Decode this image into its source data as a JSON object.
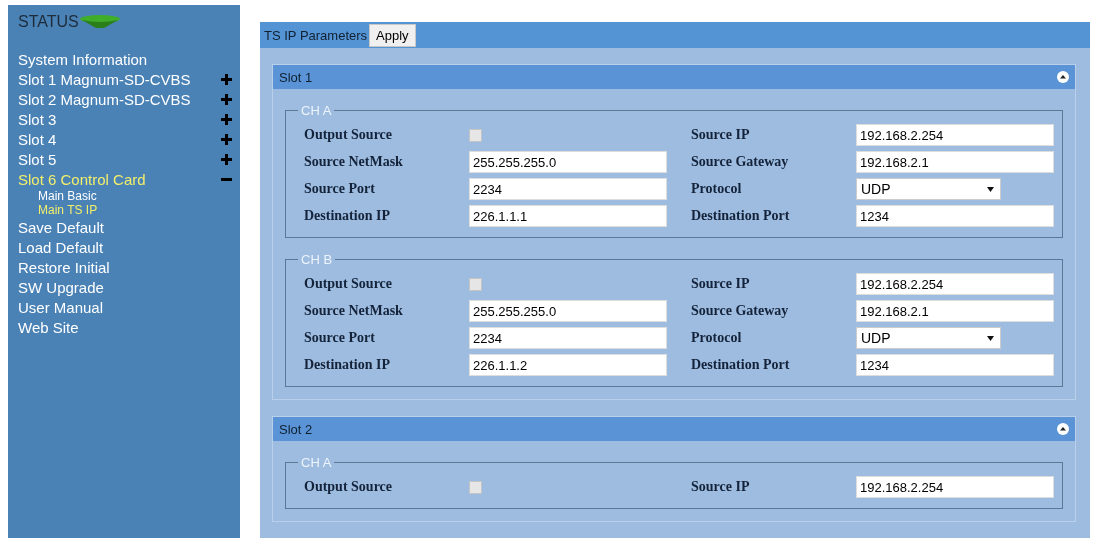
{
  "sidebar": {
    "title": "STATUS",
    "items": [
      {
        "label": "System Information",
        "selected": false
      },
      {
        "label": "Slot 1 Magnum-SD-CVBS",
        "selected": false,
        "expanded": false
      },
      {
        "label": "Slot 2 Magnum-SD-CVBS",
        "selected": false,
        "expanded": false
      },
      {
        "label": "Slot 3",
        "selected": false,
        "expanded": false
      },
      {
        "label": "Slot 4",
        "selected": false,
        "expanded": false
      },
      {
        "label": "Slot 5",
        "selected": false,
        "expanded": false
      },
      {
        "label": "Slot 6 Control Card",
        "selected": true,
        "expanded": true,
        "children": [
          {
            "label": "Main Basic",
            "selected": false
          },
          {
            "label": "Main TS IP",
            "selected": true
          }
        ]
      },
      {
        "label": "Save Default",
        "selected": false
      },
      {
        "label": "Load Default",
        "selected": false
      },
      {
        "label": "Restore Initial",
        "selected": false
      },
      {
        "label": "SW Upgrade",
        "selected": false
      },
      {
        "label": "User Manual",
        "selected": false
      },
      {
        "label": "Web Site",
        "selected": false
      }
    ]
  },
  "toolbar": {
    "title": "TS IP Parameters",
    "button": "Apply"
  },
  "slots": [
    {
      "title": "Slot 1",
      "expanded": true,
      "channels": [
        {
          "legend": "CH A",
          "fields": [
            {
              "label": "Output Source",
              "kind": "checkbox",
              "checked": false
            },
            {
              "label": "Source IP",
              "kind": "text",
              "value": "192.168.2.254"
            },
            {
              "label": "Source NetMask",
              "kind": "text",
              "value": "255.255.255.0"
            },
            {
              "label": "Source Gateway",
              "kind": "text",
              "value": "192.168.2.1"
            },
            {
              "label": "Source Port",
              "kind": "text",
              "value": "2234"
            },
            {
              "label": "Protocol",
              "kind": "select",
              "value": "UDP"
            },
            {
              "label": "Destination IP",
              "kind": "text",
              "value": "226.1.1.1"
            },
            {
              "label": "Destination Port",
              "kind": "text",
              "value": "1234"
            }
          ]
        },
        {
          "legend": "CH B",
          "fields": [
            {
              "label": "Output Source",
              "kind": "checkbox",
              "checked": false
            },
            {
              "label": "Source IP",
              "kind": "text",
              "value": "192.168.2.254"
            },
            {
              "label": "Source NetMask",
              "kind": "text",
              "value": "255.255.255.0"
            },
            {
              "label": "Source Gateway",
              "kind": "text",
              "value": "192.168.2.1"
            },
            {
              "label": "Source Port",
              "kind": "text",
              "value": "2234"
            },
            {
              "label": "Protocol",
              "kind": "select",
              "value": "UDP"
            },
            {
              "label": "Destination IP",
              "kind": "text",
              "value": "226.1.1.2"
            },
            {
              "label": "Destination Port",
              "kind": "text",
              "value": "1234"
            }
          ]
        }
      ]
    },
    {
      "title": "Slot 2",
      "expanded": true,
      "channels": [
        {
          "legend": "CH A",
          "fields": [
            {
              "label": "Output Source",
              "kind": "checkbox",
              "checked": false
            },
            {
              "label": "Source IP",
              "kind": "text",
              "value": "192.168.2.254"
            }
          ]
        }
      ]
    }
  ]
}
